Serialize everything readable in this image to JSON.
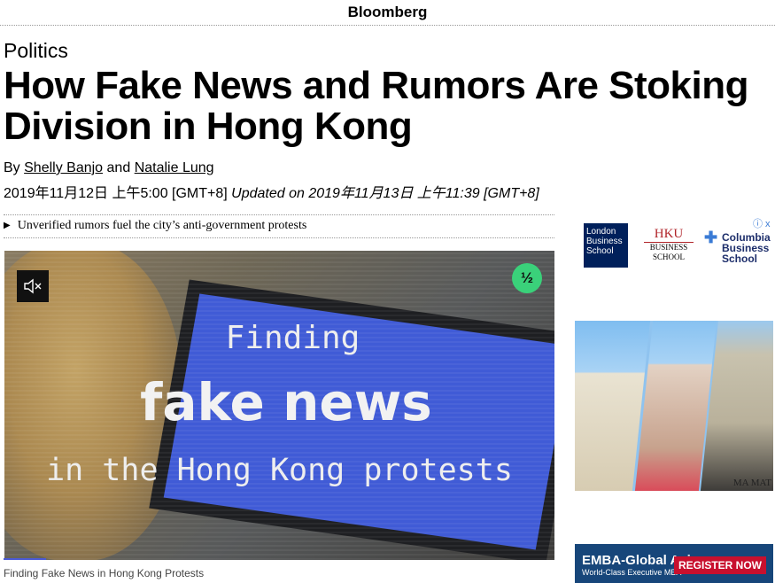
{
  "brand": "Bloomberg",
  "article": {
    "kicker": "Politics",
    "headline": "How Fake News and Rumors Are Stoking Division in Hong Kong",
    "byline_prefix": "By",
    "author1": "Shelly Banjo",
    "byline_and": "and",
    "author2": "Natalie Lung",
    "published": "2019年11月12日 上午5:00 [GMT+8]",
    "updated": "Updated on 2019年11月13日 上午11:39 [GMT+8]",
    "summary": "Unverified rumors fuel the city’s anti-government protests"
  },
  "video": {
    "line1": "Finding",
    "line2": "fake news",
    "line3": "in the Hong Kong protests",
    "badge": "½",
    "caption": "Finding Fake News in Hong Kong Protests",
    "icons": {
      "mute": "mute-icon",
      "badge": "fraction-icon"
    }
  },
  "ads": {
    "choices": "ⓘ x",
    "lbs": "London Business School",
    "hku_big": "HKU",
    "hku_small1": "BUSINESS",
    "hku_small2": "SCHOOL",
    "columbia": "Columbia Business School",
    "image_text": "MA MAT",
    "banner_title": "EMBA-Global Asia",
    "banner_sub": "World-Class Executive MBA",
    "register": "REGISTER NOW"
  },
  "colors": {
    "accent_green": "#3ad17a",
    "banner_blue": "#17467a",
    "register_red": "#c8102e"
  }
}
